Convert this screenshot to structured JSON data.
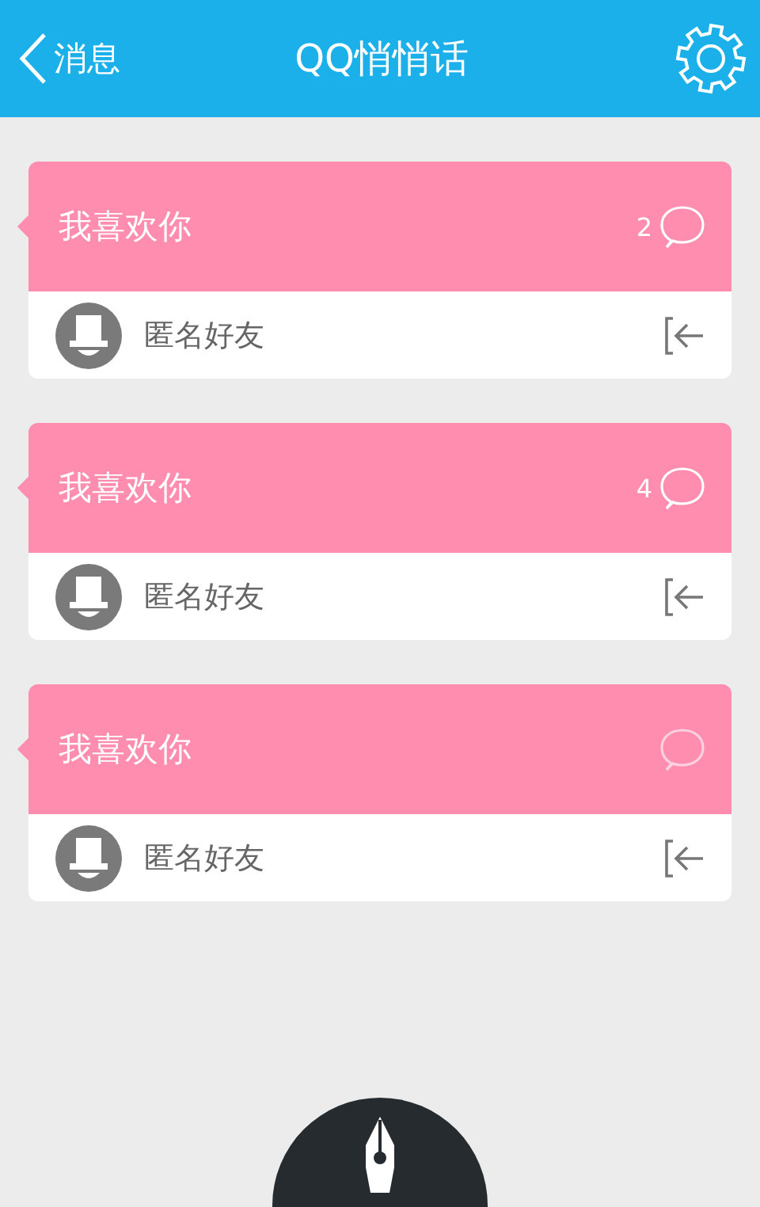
{
  "header": {
    "back_label": "消息",
    "title": "QQ悄悄话"
  },
  "messages": [
    {
      "text": "我喜欢你",
      "comment_count": "2",
      "sender": "匿名好友"
    },
    {
      "text": "我喜欢你",
      "comment_count": "4",
      "sender": "匿名好友"
    },
    {
      "text": "我喜欢你",
      "sender": "匿名好友"
    }
  ]
}
